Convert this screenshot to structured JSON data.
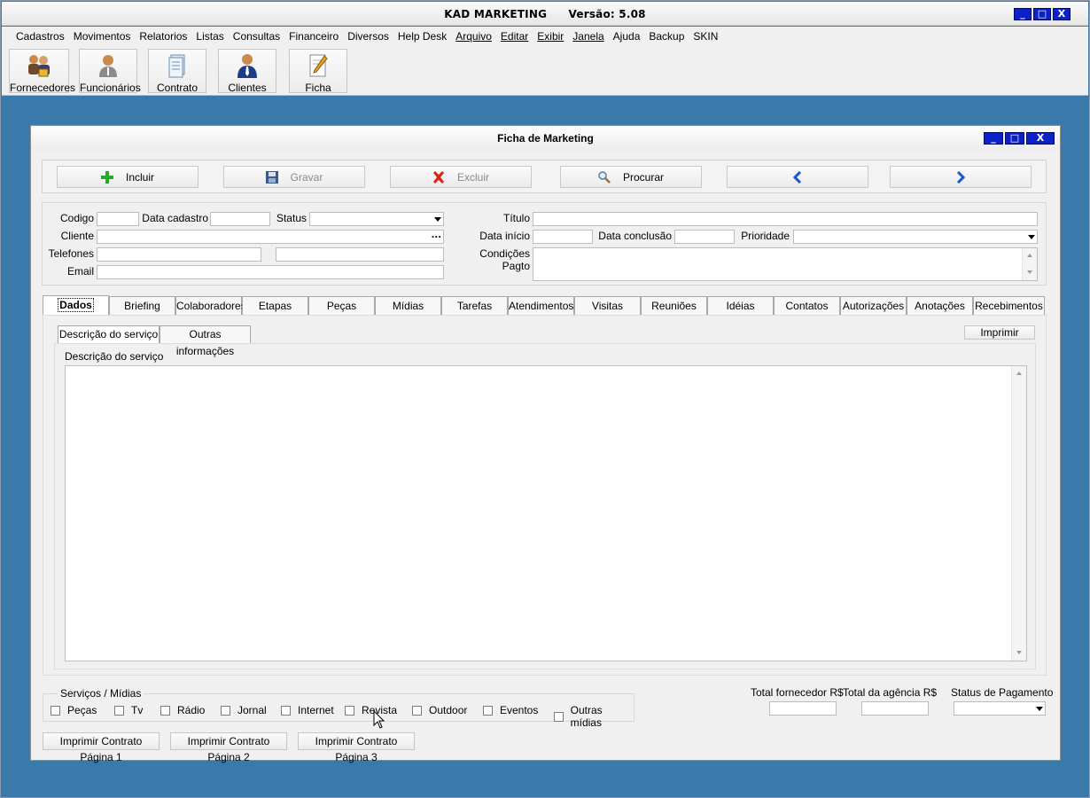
{
  "app": {
    "title": "KAD MARKETING",
    "version": "Versão: 5.08",
    "win_min": "_",
    "win_max": "□",
    "win_close": "X"
  },
  "menu": [
    "Cadastros",
    "Movimentos",
    "Relatorios",
    "Listas",
    "Consultas",
    "Financeiro",
    "Diversos",
    "Help Desk",
    "Arquivo",
    "Editar",
    "Exibir",
    "Janela",
    "Ajuda",
    "Backup",
    "SKIN"
  ],
  "toolbar": [
    {
      "label": "Fornecedores",
      "icon": "suppliers-icon"
    },
    {
      "label": "Funcionários",
      "icon": "employee-icon"
    },
    {
      "label": "Contrato",
      "icon": "contract-icon"
    },
    {
      "label": "Clientes",
      "icon": "clients-icon"
    },
    {
      "label": "Ficha",
      "icon": "form-icon"
    }
  ],
  "child": {
    "title": "Ficha de Marketing"
  },
  "actions": {
    "incluir": "Incluir",
    "gravar": "Gravar",
    "excluir": "Excluir",
    "procurar": "Procurar"
  },
  "form": {
    "codigo": "Codigo",
    "data_cadastro": "Data cadastro",
    "status": "Status",
    "titulo": "Título",
    "cliente": "Cliente",
    "data_inicio": "Data início",
    "data_conclusao": "Data conclusão",
    "prioridade": "Prioridade",
    "telefones": "Telefones",
    "condicoes": "Condições Pagto",
    "email": "Email",
    "ellipsis": "..."
  },
  "tabs": [
    "Dados",
    "Briefing",
    "Colaboradores",
    "Etapas",
    "Peças",
    "Mídias",
    "Tarefas",
    "Atendimentos",
    "Visitas",
    "Reuniões",
    "Idéias",
    "Contatos",
    "Autorizações",
    "Anotações",
    "Recebimentos"
  ],
  "subtabs": [
    "Descrição do serviço",
    "Outras informações"
  ],
  "panel": {
    "print": "Imprimir",
    "memo_label": "Descrição do serviço"
  },
  "services": {
    "legend": "Serviços / Mídias",
    "items": [
      "Peças",
      "Tv",
      "Rádio",
      "Jornal",
      "Internet",
      "Revista",
      "Outdoor",
      "Eventos",
      "Outras mídias"
    ]
  },
  "totals": {
    "fornecedor": "Total fornecedor R$",
    "agencia": "Total da agência R$",
    "status_pag": "Status de Pagamento"
  },
  "print_buttons": [
    "Imprimir Contrato Página 1",
    "Imprimir Contrato Página 2",
    "Imprimir Contrato Página 3"
  ]
}
